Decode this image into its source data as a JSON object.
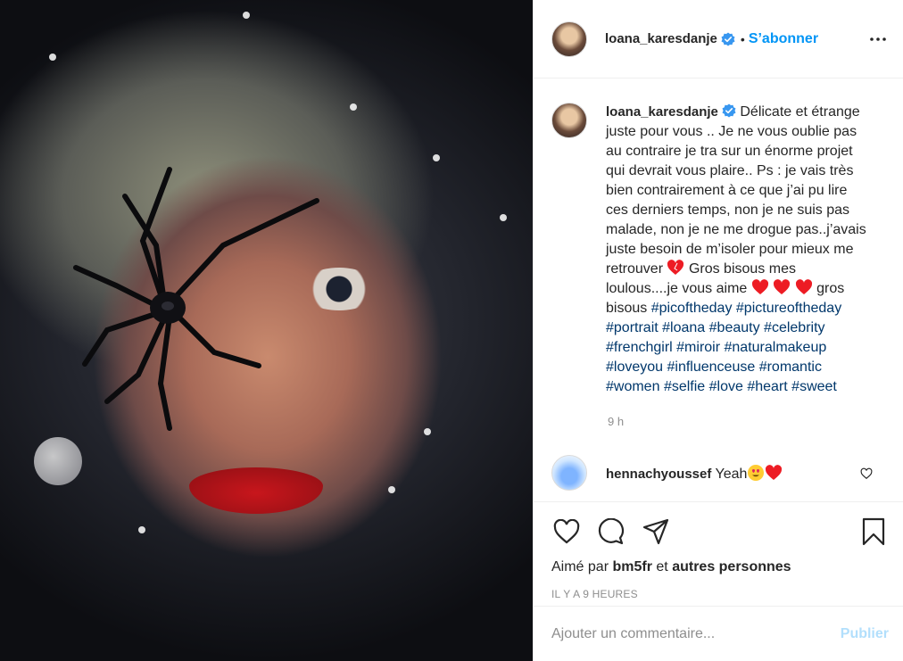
{
  "post": {
    "username": "loana_karesdanje",
    "follow_label": "S’abonner",
    "separator": "•"
  },
  "caption": {
    "username": "loana_karesdanje",
    "text_part1": "Délicate et étrange juste pour vous .. Je ne vous oublie pas au contraire je tra sur un énorme projet qui devrait vous plaire.. Ps : je vais très bien contrairement à ce que j’ai pu lire ces derniers temps, non je ne suis pas malade, non je ne me drogue pas..j’avais juste besoin de m’isoler pour mieux me retrouver",
    "text_part2": "Gros bisous mes loulous....je vous aime",
    "text_part3": "gros bisous",
    "hashtags": [
      "#picoftheday",
      "#pictureoftheday",
      "#portrait",
      "#loana",
      "#beauty",
      "#celebrity",
      "#frenchgirl",
      "#miroir",
      "#naturalmakeup",
      "#loveyou",
      "#influenceuse",
      "#romantic",
      "#women",
      "#selfie",
      "#love",
      "#heart",
      "#sweet"
    ],
    "timestamp": "9 h"
  },
  "comment": {
    "username": "hennachyoussef",
    "text": "Yeah"
  },
  "likes": {
    "prefix": "Aimé par",
    "user": "bm5fr",
    "connector": "et",
    "others": "autres personnes"
  },
  "time_ago": "IL Y A 9 HEURES",
  "add_comment": {
    "placeholder": "Ajouter un commentaire...",
    "publish_label": "Publier"
  },
  "colors": {
    "accent": "#0095f6",
    "hashtag": "#00376b",
    "heart": "#ed1c24",
    "publish_disabled": "#b2dffc"
  },
  "icons": {
    "verified": "verified-badge-icon",
    "more": "more-options-icon",
    "like": "heart-outline-icon",
    "comment": "comment-bubble-icon",
    "share": "paper-plane-icon",
    "save": "bookmark-icon"
  }
}
